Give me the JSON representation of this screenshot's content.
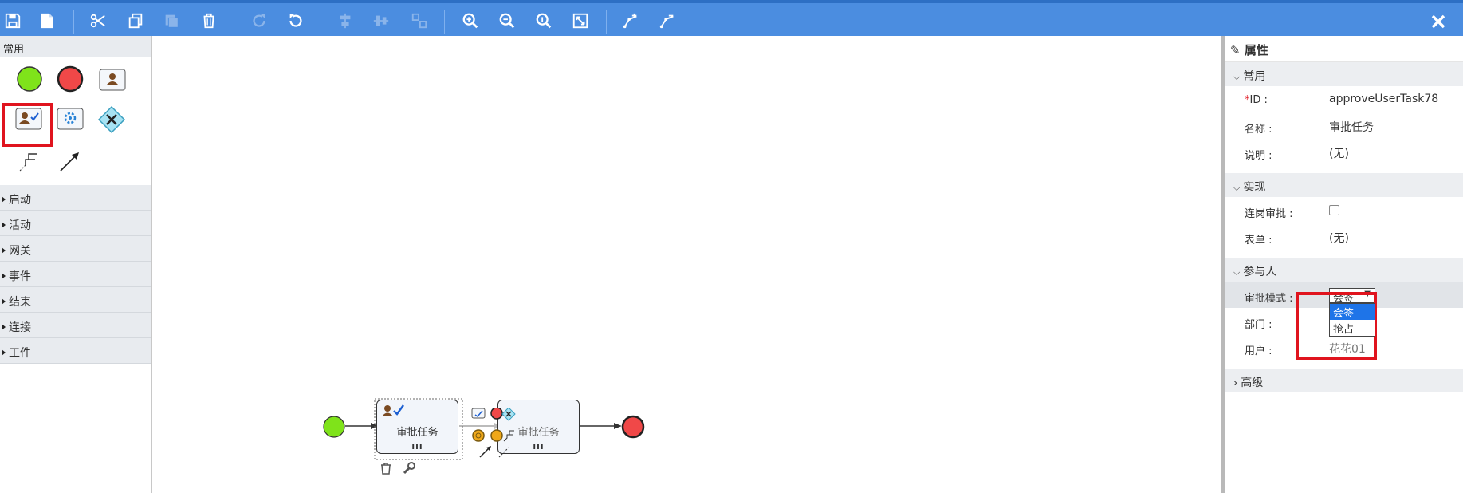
{
  "toolbar": {
    "buttons": [
      "save-icon",
      "new-file-icon",
      "cut-icon",
      "copy-icon",
      "paste-icon",
      "delete-icon",
      "redo-icon",
      "undo-icon",
      "align-horizontal-icon",
      "align-vertical-icon",
      "same-size-icon",
      "zoom-in-icon",
      "zoom-out-icon",
      "zoom-actual-icon",
      "fit-screen-icon",
      "add-bendpoint-icon",
      "remove-bendpoint-icon"
    ],
    "close": "close-icon"
  },
  "palette": {
    "header": "常用",
    "categories": [
      "启动",
      "活动",
      "网关",
      "事件",
      "结束",
      "连接",
      "工件"
    ]
  },
  "canvas": {
    "task1_label": "审批任务",
    "task2_label": "审批任务",
    "task_marker": "III"
  },
  "properties": {
    "title": "属性",
    "sections": {
      "general": "常用",
      "implementation": "实现",
      "participants": "参与人",
      "advanced": "高级"
    },
    "fields": {
      "id_required": "*",
      "id_label": "ID :",
      "id_value": "approveUserTask78",
      "name_label": "名称 :",
      "name_value": "审批任务",
      "desc_label": "说明 :",
      "desc_value": "(无)",
      "consecutive_label": "连岗审批 :",
      "form_label": "表单 :",
      "form_value": "(无)",
      "mode_label": "审批模式 :",
      "mode_value": "会签",
      "mode_options": [
        "会签",
        "抢占"
      ],
      "dept_label": "部门 :",
      "user_label": "用户 :",
      "user_value": "花花01"
    }
  },
  "colors": {
    "toolbar": "#4b8de0",
    "start": "#7fe31a",
    "end": "#f04848",
    "highlight": "#e0141e"
  }
}
